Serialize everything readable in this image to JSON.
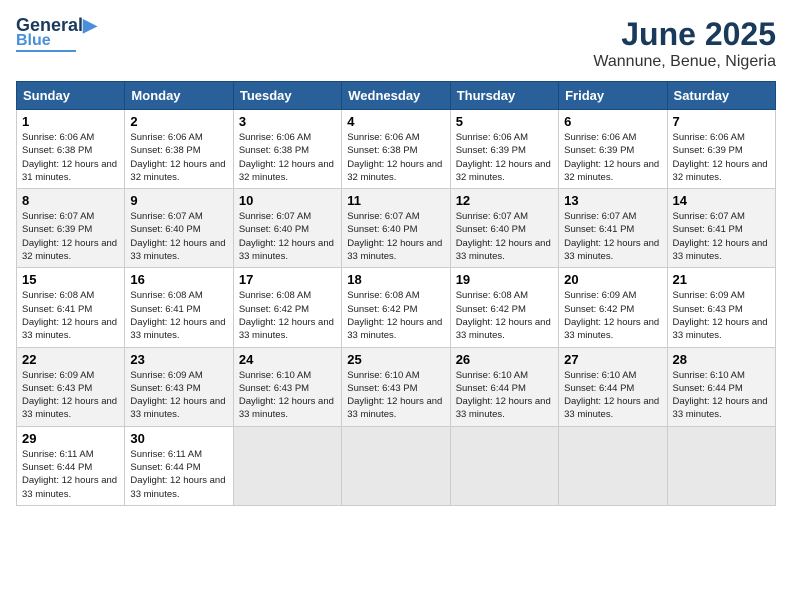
{
  "header": {
    "logo_line1": "General",
    "logo_line2": "Blue",
    "month": "June 2025",
    "location": "Wannune, Benue, Nigeria"
  },
  "columns": [
    "Sunday",
    "Monday",
    "Tuesday",
    "Wednesday",
    "Thursday",
    "Friday",
    "Saturday"
  ],
  "weeks": [
    [
      {
        "day": "1",
        "sunrise": "6:06 AM",
        "sunset": "6:38 PM",
        "daylight": "12 hours and 31 minutes."
      },
      {
        "day": "2",
        "sunrise": "6:06 AM",
        "sunset": "6:38 PM",
        "daylight": "12 hours and 32 minutes."
      },
      {
        "day": "3",
        "sunrise": "6:06 AM",
        "sunset": "6:38 PM",
        "daylight": "12 hours and 32 minutes."
      },
      {
        "day": "4",
        "sunrise": "6:06 AM",
        "sunset": "6:38 PM",
        "daylight": "12 hours and 32 minutes."
      },
      {
        "day": "5",
        "sunrise": "6:06 AM",
        "sunset": "6:39 PM",
        "daylight": "12 hours and 32 minutes."
      },
      {
        "day": "6",
        "sunrise": "6:06 AM",
        "sunset": "6:39 PM",
        "daylight": "12 hours and 32 minutes."
      },
      {
        "day": "7",
        "sunrise": "6:06 AM",
        "sunset": "6:39 PM",
        "daylight": "12 hours and 32 minutes."
      }
    ],
    [
      {
        "day": "8",
        "sunrise": "6:07 AM",
        "sunset": "6:39 PM",
        "daylight": "12 hours and 32 minutes."
      },
      {
        "day": "9",
        "sunrise": "6:07 AM",
        "sunset": "6:40 PM",
        "daylight": "12 hours and 33 minutes."
      },
      {
        "day": "10",
        "sunrise": "6:07 AM",
        "sunset": "6:40 PM",
        "daylight": "12 hours and 33 minutes."
      },
      {
        "day": "11",
        "sunrise": "6:07 AM",
        "sunset": "6:40 PM",
        "daylight": "12 hours and 33 minutes."
      },
      {
        "day": "12",
        "sunrise": "6:07 AM",
        "sunset": "6:40 PM",
        "daylight": "12 hours and 33 minutes."
      },
      {
        "day": "13",
        "sunrise": "6:07 AM",
        "sunset": "6:41 PM",
        "daylight": "12 hours and 33 minutes."
      },
      {
        "day": "14",
        "sunrise": "6:07 AM",
        "sunset": "6:41 PM",
        "daylight": "12 hours and 33 minutes."
      }
    ],
    [
      {
        "day": "15",
        "sunrise": "6:08 AM",
        "sunset": "6:41 PM",
        "daylight": "12 hours and 33 minutes."
      },
      {
        "day": "16",
        "sunrise": "6:08 AM",
        "sunset": "6:41 PM",
        "daylight": "12 hours and 33 minutes."
      },
      {
        "day": "17",
        "sunrise": "6:08 AM",
        "sunset": "6:42 PM",
        "daylight": "12 hours and 33 minutes."
      },
      {
        "day": "18",
        "sunrise": "6:08 AM",
        "sunset": "6:42 PM",
        "daylight": "12 hours and 33 minutes."
      },
      {
        "day": "19",
        "sunrise": "6:08 AM",
        "sunset": "6:42 PM",
        "daylight": "12 hours and 33 minutes."
      },
      {
        "day": "20",
        "sunrise": "6:09 AM",
        "sunset": "6:42 PM",
        "daylight": "12 hours and 33 minutes."
      },
      {
        "day": "21",
        "sunrise": "6:09 AM",
        "sunset": "6:43 PM",
        "daylight": "12 hours and 33 minutes."
      }
    ],
    [
      {
        "day": "22",
        "sunrise": "6:09 AM",
        "sunset": "6:43 PM",
        "daylight": "12 hours and 33 minutes."
      },
      {
        "day": "23",
        "sunrise": "6:09 AM",
        "sunset": "6:43 PM",
        "daylight": "12 hours and 33 minutes."
      },
      {
        "day": "24",
        "sunrise": "6:10 AM",
        "sunset": "6:43 PM",
        "daylight": "12 hours and 33 minutes."
      },
      {
        "day": "25",
        "sunrise": "6:10 AM",
        "sunset": "6:43 PM",
        "daylight": "12 hours and 33 minutes."
      },
      {
        "day": "26",
        "sunrise": "6:10 AM",
        "sunset": "6:44 PM",
        "daylight": "12 hours and 33 minutes."
      },
      {
        "day": "27",
        "sunrise": "6:10 AM",
        "sunset": "6:44 PM",
        "daylight": "12 hours and 33 minutes."
      },
      {
        "day": "28",
        "sunrise": "6:10 AM",
        "sunset": "6:44 PM",
        "daylight": "12 hours and 33 minutes."
      }
    ],
    [
      {
        "day": "29",
        "sunrise": "6:11 AM",
        "sunset": "6:44 PM",
        "daylight": "12 hours and 33 minutes."
      },
      {
        "day": "30",
        "sunrise": "6:11 AM",
        "sunset": "6:44 PM",
        "daylight": "12 hours and 33 minutes."
      },
      null,
      null,
      null,
      null,
      null
    ]
  ]
}
